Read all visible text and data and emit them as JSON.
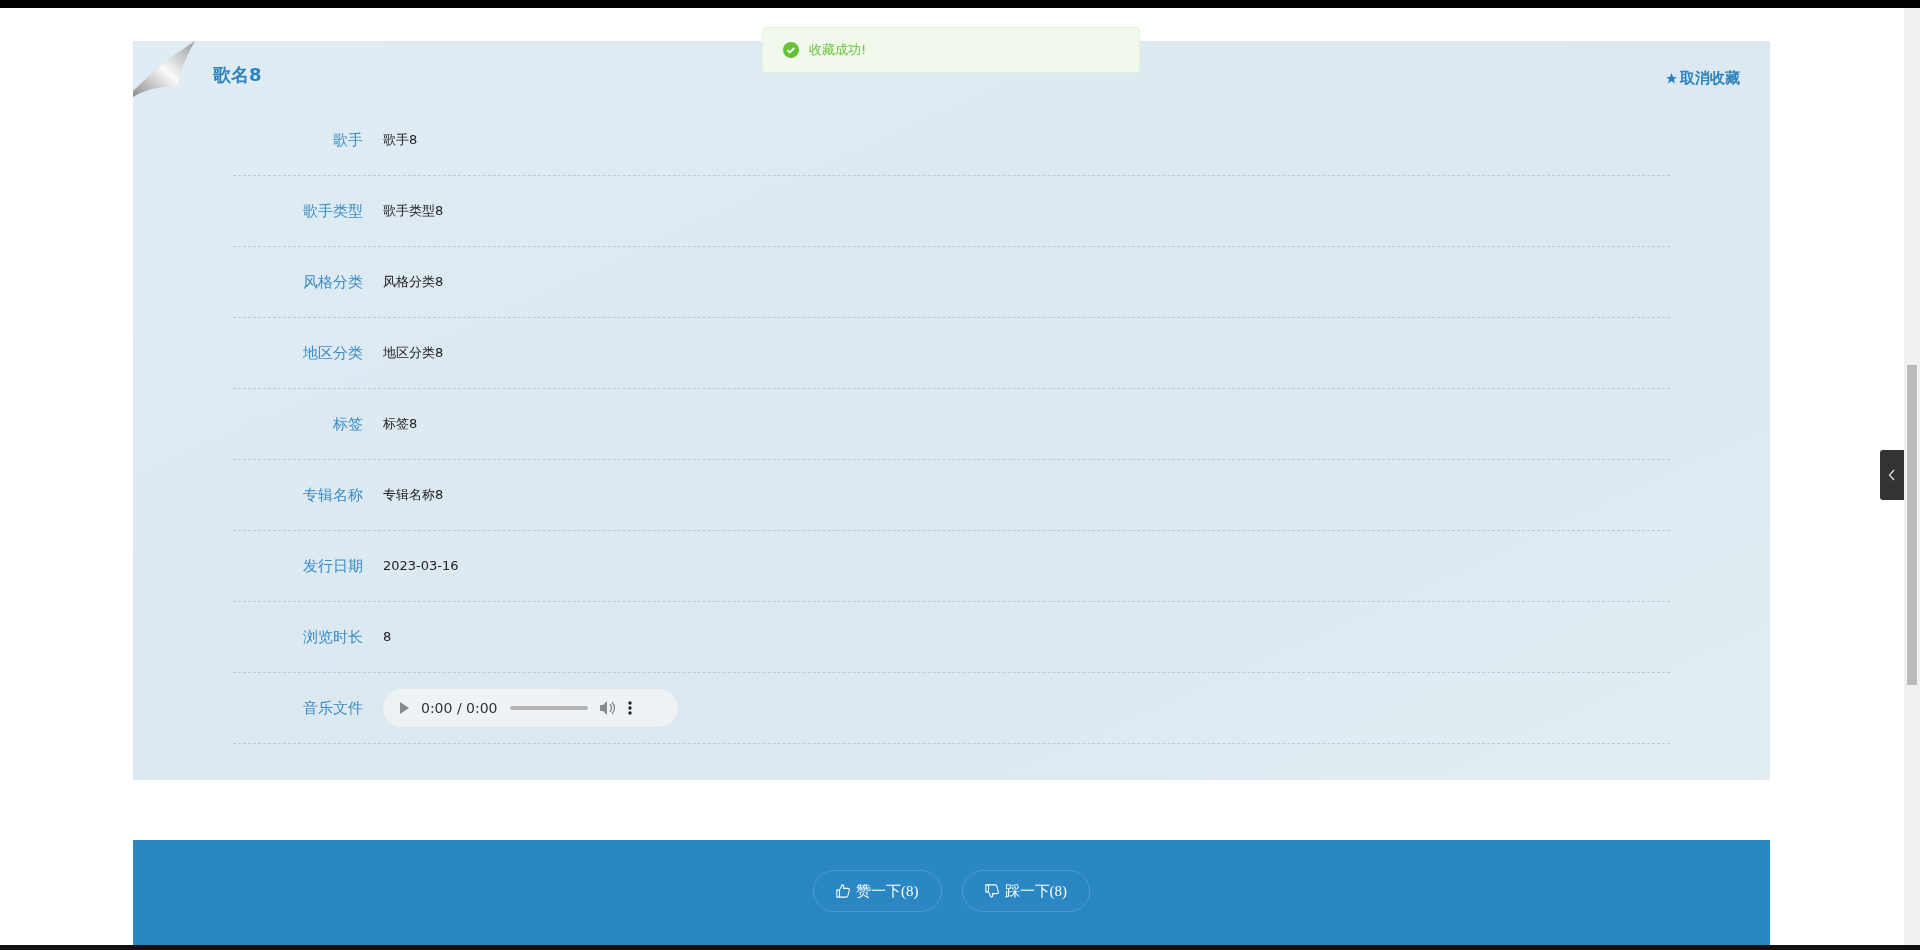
{
  "toast": {
    "text": "收藏成功!"
  },
  "song": {
    "title": "歌名8",
    "favorite_action": "取消收藏"
  },
  "fields": [
    {
      "kind": "text",
      "label": "歌手",
      "value": "歌手8"
    },
    {
      "kind": "text",
      "label": "歌手类型",
      "value": "歌手类型8"
    },
    {
      "kind": "text",
      "label": "风格分类",
      "value": "风格分类8"
    },
    {
      "kind": "text",
      "label": "地区分类",
      "value": "地区分类8"
    },
    {
      "kind": "text",
      "label": "标签",
      "value": "标签8"
    },
    {
      "kind": "text",
      "label": "专辑名称",
      "value": "专辑名称8"
    },
    {
      "kind": "text",
      "label": "发行日期",
      "value": "2023-03-16"
    },
    {
      "kind": "text",
      "label": "浏览时长",
      "value": "8"
    },
    {
      "kind": "audio",
      "label": "音乐文件",
      "value": "0:00 / 0:00"
    }
  ],
  "buttons": [
    {
      "kind": "like",
      "label": "赞一下(8)"
    },
    {
      "kind": "dislike",
      "label": "踩一下(8)"
    }
  ]
}
